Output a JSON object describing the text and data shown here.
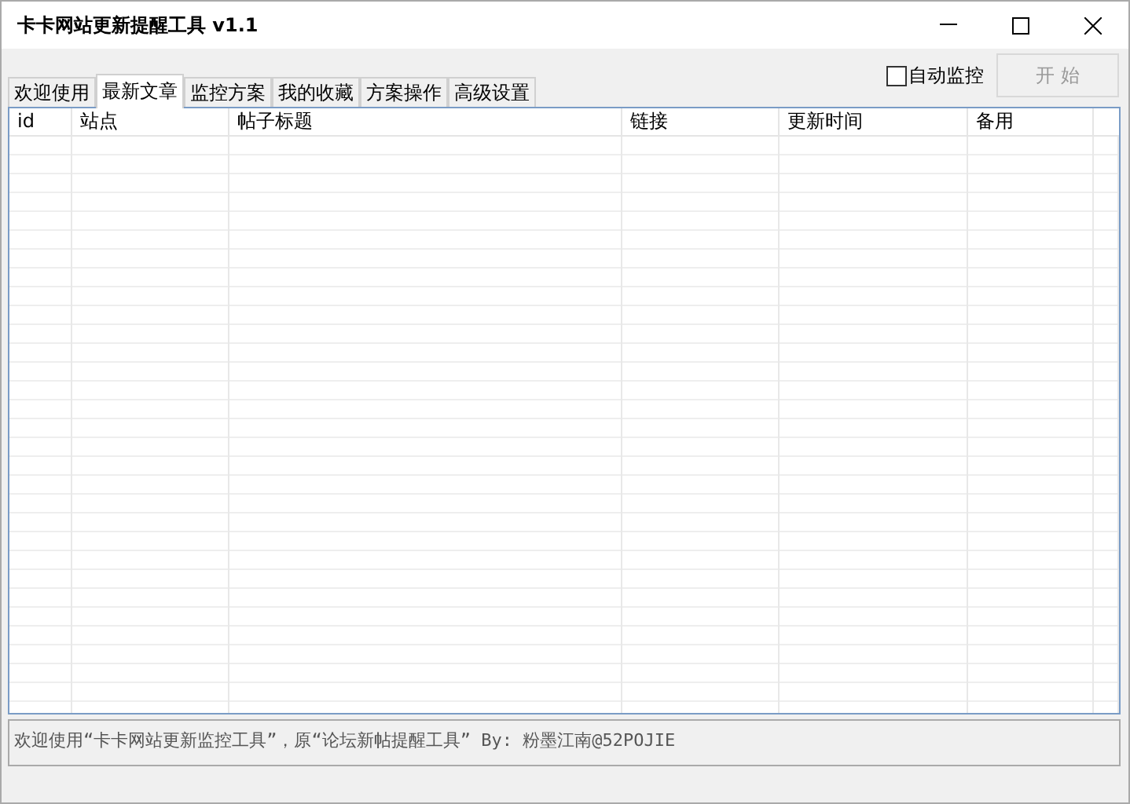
{
  "window": {
    "title": "卡卡网站更新提醒工具 v1.1"
  },
  "tabs": [
    {
      "label": "欢迎使用",
      "selected": false
    },
    {
      "label": "最新文章",
      "selected": true
    },
    {
      "label": "监控方案",
      "selected": false
    },
    {
      "label": "我的收藏",
      "selected": false
    },
    {
      "label": "方案操作",
      "selected": false
    },
    {
      "label": "高级设置",
      "selected": false
    }
  ],
  "auto_monitor": {
    "label": "自动监控",
    "checked": false
  },
  "start_button": {
    "label": "开 始",
    "disabled": true
  },
  "table": {
    "columns": [
      "id",
      "站点",
      "帖子标题",
      "链接",
      "更新时间",
      "备用"
    ]
  },
  "status_text": "欢迎使用“卡卡网站更新监控工具”，原“论坛新帖提醒工具” By: 粉墨江南@52POJIE"
}
